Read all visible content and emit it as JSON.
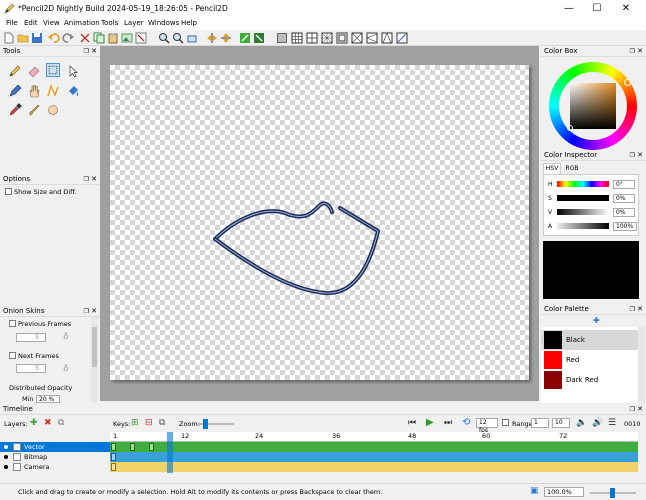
{
  "window": {
    "title": "*Pencil2D Nightly Build 2024-05-19_18:26:05 - Pencil2D",
    "minimize": "—",
    "maximize": "☐",
    "close": "✕"
  },
  "menu": [
    "File",
    "Edit",
    "View",
    "Animation",
    "Tools",
    "Layer",
    "Windows",
    "Help"
  ],
  "panels": {
    "tools": {
      "title": "Tools"
    },
    "options": {
      "title": "Options",
      "show_size_diff": "Show Size and Diff."
    },
    "onion": {
      "title": "Onion Skins",
      "previous_frames": "Previous Frames",
      "prev_value": "5",
      "next_frames": "Next Frames",
      "next_value": "5",
      "distributed_opacity": "Distributed Opacity",
      "min_label": "Min",
      "min_value": "20 %"
    },
    "color_box": {
      "title": "Color Box"
    },
    "color_inspector": {
      "title": "Color Inspector",
      "tab_hsv": "HSV",
      "tab_rgb": "RGB",
      "h_label": "H",
      "h_value": "0°",
      "s_label": "S",
      "s_value": "0%",
      "v_label": "V",
      "v_value": "0%",
      "a_label": "A",
      "a_value": "100%",
      "preview_color": "#000000"
    },
    "color_palette": {
      "title": "Color Palette",
      "colors": [
        {
          "name": "Black",
          "hex": "#000000"
        },
        {
          "name": "Red",
          "hex": "#ff0000"
        },
        {
          "name": "Dark Red",
          "hex": "#8b0000"
        }
      ]
    }
  },
  "timeline": {
    "title": "Timeline",
    "layers_label": "Layers:",
    "keys_label": "Keys:",
    "zoom_label": "Zoom:",
    "fps": "12 fps",
    "range_label": "Range",
    "range_start": "1",
    "range_end": "10",
    "frame_counter": "0010",
    "ruler": [
      "1",
      "12",
      "24",
      "36",
      "48",
      "60",
      "72"
    ],
    "layers": [
      {
        "name": "Vector",
        "selected": true
      },
      {
        "name": "Bitmap",
        "selected": false
      },
      {
        "name": "Camera",
        "selected": false
      }
    ]
  },
  "status": {
    "message": "Click and drag to create or modify a selection. Hold Alt to modify its contents or press Backspace to clear them.",
    "zoom": "100.0%"
  },
  "colors": {
    "accent": "#0078d7",
    "vector_track": "#3fae3f",
    "bitmap_track": "#3aa0d8",
    "camera_track": "#f2d26b",
    "stroke": "#1c2c5a"
  }
}
